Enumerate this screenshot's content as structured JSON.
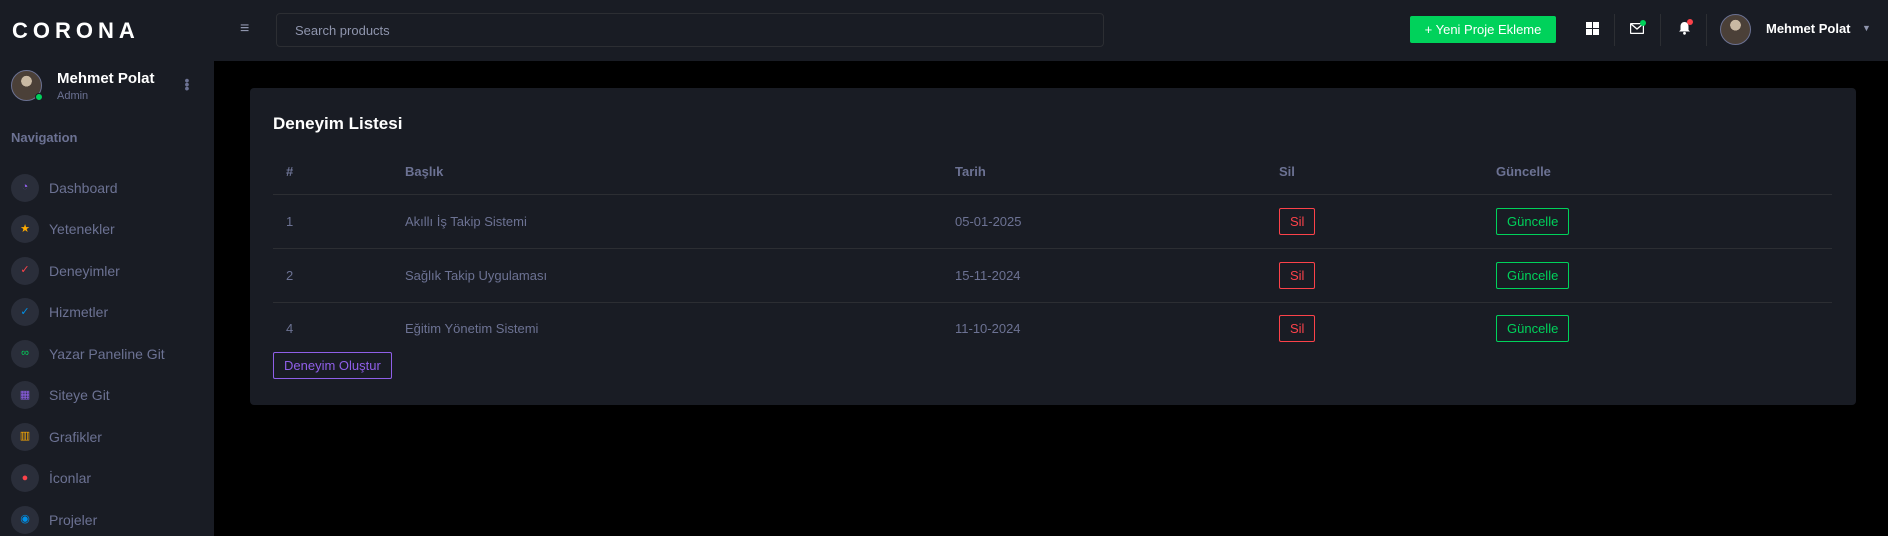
{
  "brand": "CORONA",
  "profile": {
    "name": "Mehmet Polat",
    "role": "Admin"
  },
  "nav": {
    "heading": "Navigation",
    "items": [
      {
        "label": "Dashboard",
        "icon": "speedometer-icon",
        "glyph": "◔",
        "color": "#8f5fe8"
      },
      {
        "label": "Yetenekler",
        "icon": "star-icon",
        "glyph": "★",
        "color": "#ffab00"
      },
      {
        "label": "Deneyimler",
        "icon": "check-circle-icon",
        "glyph": "✓",
        "color": "#fc424a"
      },
      {
        "label": "Hizmetler",
        "icon": "check-circle-icon",
        "glyph": "✓",
        "color": "#0090e7"
      },
      {
        "label": "Yazar Paneline Git",
        "icon": "link-icon",
        "glyph": "∞",
        "color": "#00d25b"
      },
      {
        "label": "Siteye Git",
        "icon": "grid-icon",
        "glyph": "▦",
        "color": "#8f5fe8"
      },
      {
        "label": "Grafikler",
        "icon": "bar-chart-icon",
        "glyph": "▥",
        "color": "#ffab00"
      },
      {
        "label": "İconlar",
        "icon": "pin-icon",
        "glyph": "●",
        "color": "#fc424a"
      },
      {
        "label": "Projeler",
        "icon": "github-icon",
        "glyph": "◉",
        "color": "#0090e7"
      }
    ]
  },
  "topbar": {
    "search_placeholder": "Search products",
    "new_button": "+ Yeni Proje Ekleme",
    "user_name": "Mehmet Polat",
    "mail_dot_color": "#00d25b",
    "bell_dot_color": "#fc424a"
  },
  "card": {
    "title": "Deneyim Listesi",
    "columns": [
      "#",
      "Başlık",
      "Tarih",
      "Sil",
      "Güncelle"
    ],
    "rows": [
      {
        "id": "1",
        "title": "Akıllı İş Takip Sistemi",
        "date": "05-01-2025",
        "delete": "Sil",
        "update": "Güncelle"
      },
      {
        "id": "2",
        "title": "Sağlık Takip Uygulaması",
        "date": "15-11-2024",
        "delete": "Sil",
        "update": "Güncelle"
      },
      {
        "id": "4",
        "title": "Eğitim Yönetim Sistemi",
        "date": "11-10-2024",
        "delete": "Sil",
        "update": "Güncelle"
      }
    ],
    "create_button": "Deneyim Oluştur"
  },
  "colors": {
    "sidebar_bg": "#191c24",
    "page_bg": "#000000",
    "success": "#00d25b",
    "danger": "#fc424a",
    "primary": "#8f5fe8",
    "muted": "#6c7293"
  }
}
